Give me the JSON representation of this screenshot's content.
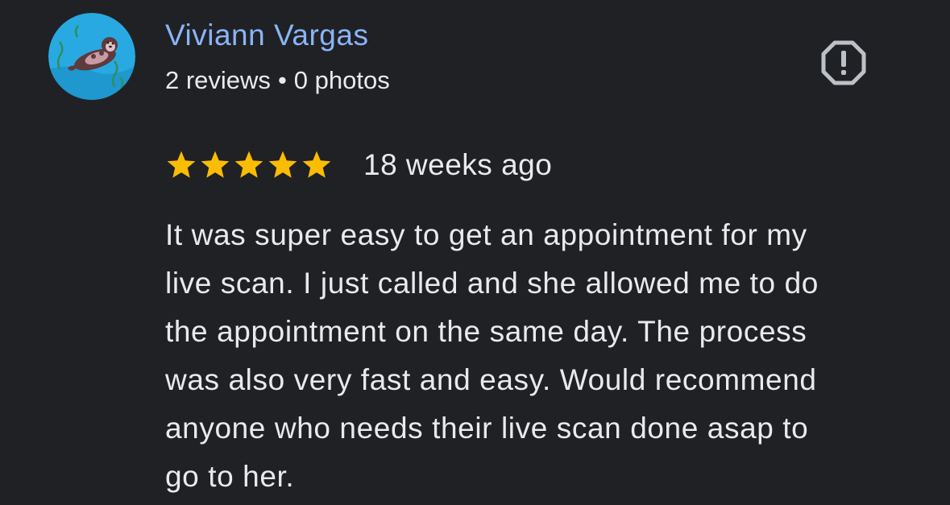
{
  "author": {
    "name": "Viviann Vargas",
    "reviews_count": "2 reviews",
    "separator": "•",
    "photos_count": "0 photos",
    "avatar_icon": "sea-otter-avatar-icon"
  },
  "report": {
    "icon": "report-flag-octagon-icon"
  },
  "review": {
    "rating": 5,
    "max_rating": 5,
    "date": "18 weeks ago",
    "text_lines": [
      "It was super easy to get an appointment for my",
      "live scan. I just called and she allowed me to do",
      "the appointment on the same day. The process",
      "was also very fast and easy. Would recommend",
      "anyone who needs their live scan done asap to",
      "go to her."
    ]
  },
  "colors": {
    "background": "#202124",
    "author_name": "#8ab4f8",
    "text": "#e8eaed",
    "star": "#fbbc04",
    "icon": "#bdc1c6",
    "avatar_bg": "#29a9e1"
  }
}
